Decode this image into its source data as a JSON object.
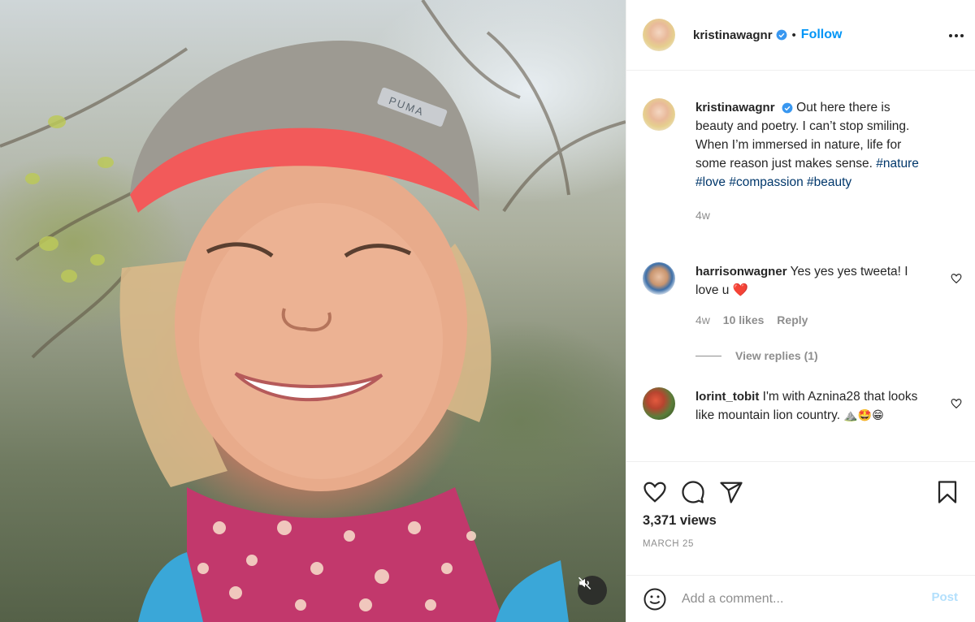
{
  "post": {
    "author": {
      "username": "kristinawagnr",
      "verified": true,
      "follow_label": "Follow",
      "separator": "•"
    },
    "caption": {
      "username": "kristinawagnr",
      "text": "Out here there is beauty and poetry. I can’t stop smiling. When I’m immersed in nature, life for some reason just makes sense.",
      "hashtags": [
        "#nature",
        "#love",
        "#compassion",
        "#beauty"
      ],
      "time": "4w"
    },
    "comments": [
      {
        "username": "harrisonwagner",
        "text": "Yes yes yes tweeta! I love u",
        "emoji": "❤️",
        "time": "4w",
        "likes": "10 likes",
        "reply_label": "Reply",
        "view_replies": "View replies (1)"
      },
      {
        "username": "lorint_tobit",
        "text": "I'm with Aznina28 that looks like mountain lion country.",
        "emoji": "⛰️🤩😁"
      }
    ],
    "views": "3,371 views",
    "date": "MARCH 25",
    "add_comment": {
      "placeholder": "Add a comment...",
      "post_label": "Post"
    }
  },
  "icons": {
    "verified": "verified-badge-icon",
    "more": "more-options-icon",
    "like": "heart-icon",
    "comment": "comment-bubble-icon",
    "share": "paper-plane-icon",
    "save": "bookmark-icon",
    "emoji": "smiley-icon",
    "mute": "muted-speaker-icon"
  },
  "colors": {
    "link_blue": "#0095f6",
    "hashtag": "#00376b",
    "muted_text": "#8e8e8e",
    "heart_red": "#ed4956"
  }
}
